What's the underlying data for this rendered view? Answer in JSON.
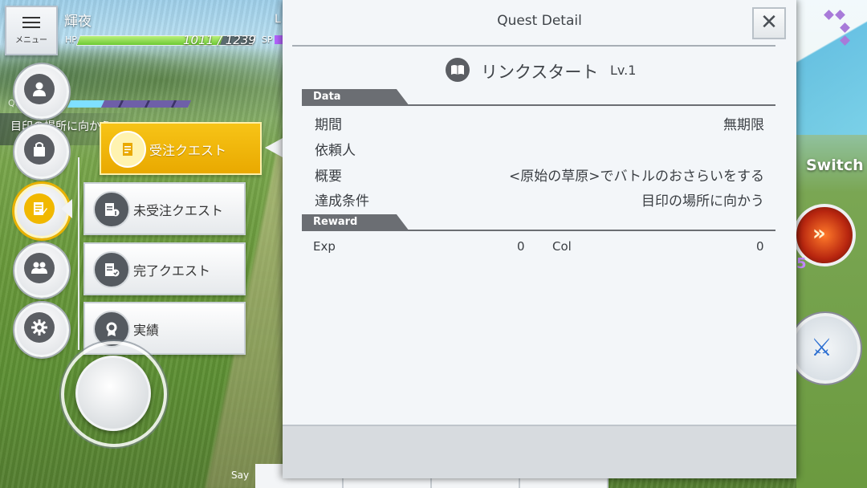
{
  "hud": {
    "menu_label": "メニュー",
    "player_name": "輝夜",
    "level_prefix": "L",
    "hp_label": "HP",
    "hp_value": "1011 / 1239",
    "hp_fraction": 0.816,
    "sp_label": "SP",
    "quest_tracker_label": "Qu",
    "objective_text": "目印の場所に向かう",
    "switch_label": "Switch",
    "skill_value": "5",
    "chat_label": "Say"
  },
  "quest_menu": {
    "items": [
      {
        "label": "受注クエスト",
        "icon": "document-icon",
        "selected": true
      },
      {
        "label": "未受注クエスト",
        "icon": "document-info-icon",
        "selected": false
      },
      {
        "label": "完了クエスト",
        "icon": "document-check-icon",
        "selected": false
      },
      {
        "label": "実績",
        "icon": "medal-icon",
        "selected": false
      }
    ]
  },
  "side_buttons": [
    "person-icon",
    "bag-icon",
    "quest-icon",
    "party-icon",
    "gear-icon"
  ],
  "dialog": {
    "title": "Quest Detail",
    "close_glyph": "✕",
    "quest_name": "リンクスタート",
    "quest_level": "Lv.1",
    "data_section": "Data",
    "rows": [
      {
        "label": "期間",
        "value": "無期限"
      },
      {
        "label": "依頼人",
        "value": ""
      },
      {
        "label": "概要",
        "value": "<原始の草原>でバトルのおさらいをする"
      },
      {
        "label": "達成条件",
        "value": "目印の場所に向かう"
      }
    ],
    "reward_section": "Reward",
    "reward": {
      "exp_label": "Exp",
      "exp_value": "0",
      "col_label": "Col",
      "col_value": "0"
    }
  },
  "colors": {
    "accent_yellow": "#f1b800",
    "hp_green": "#6cc934",
    "sp_purple": "#b565ff",
    "dialog_bg": "#f3f6f9",
    "section_tab": "#6b6e73"
  }
}
